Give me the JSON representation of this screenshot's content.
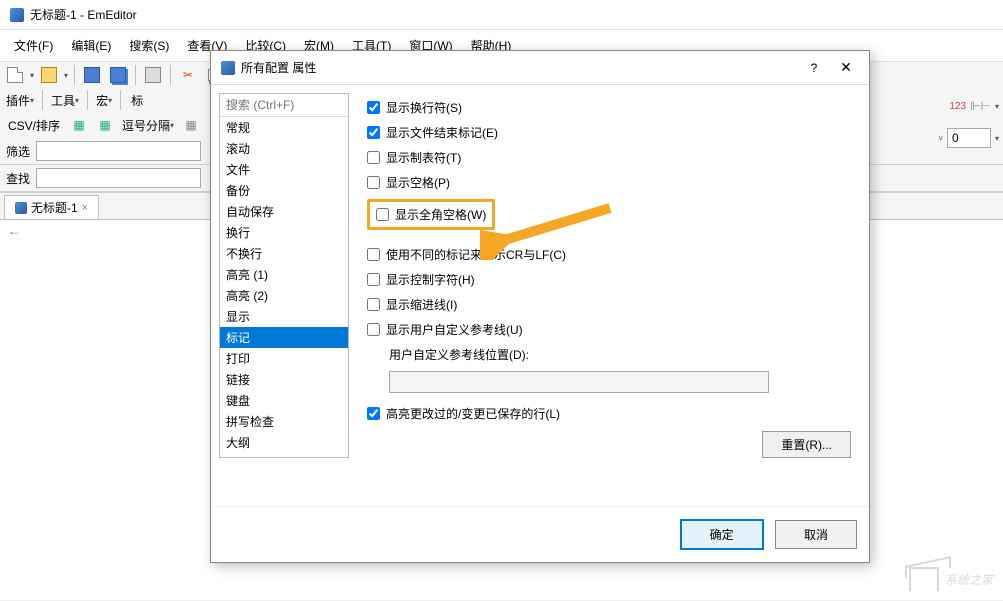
{
  "window": {
    "title": "无标题-1 - EmEditor"
  },
  "menu": {
    "file": "文件(F)",
    "edit": "编辑(E)",
    "search": "搜索(S)",
    "view": "查看(V)",
    "compare": "比较(C)",
    "macro": "宏(M)",
    "tools": "工具(T)",
    "window": "窗口(W)",
    "help": "帮助(H)"
  },
  "toolbar": {
    "plugins": "插件",
    "tools": "工具",
    "macro": "宏",
    "tabs_label": "标",
    "csv_sort": "CSV/排序",
    "comma_split": "逗号分隔",
    "filter_label": "筛选",
    "search_label": "查找",
    "col_number": "0",
    "ruler_mark": "123"
  },
  "tabs": {
    "doc1": "无标题-1"
  },
  "editor": {
    "eof_marker": "←"
  },
  "dialog": {
    "title": "所有配置 属性",
    "help": "?",
    "search_placeholder": "搜索 (Ctrl+F)",
    "categories": [
      "常规",
      "滚动",
      "文件",
      "备份",
      "自动保存",
      "换行",
      "不换行",
      "高亮 (1)",
      "高亮 (2)",
      "显示",
      "标记",
      "打印",
      "链接",
      "键盘",
      "拼写检查",
      "大纲"
    ],
    "selected_category_index": 10,
    "options": {
      "show_newline": "显示换行符(S)",
      "show_eof": "显示文件结束标记(E)",
      "show_tab": "显示制表符(T)",
      "show_space": "显示空格(P)",
      "show_fullwidth_space": "显示全角空格(W)",
      "diff_crlf": "使用不同的标记来显示CR与LF(C)",
      "show_ctrl": "显示控制字符(H)",
      "show_indent": "显示缩进线(I)",
      "show_user_guide": "显示用户自定义参考线(U)",
      "user_guide_pos": "用户自定义参考线位置(D):",
      "highlight_changed": "高亮更改过的/变更已保存的行(L)"
    },
    "checked": {
      "show_newline": true,
      "show_eof": true,
      "highlight_changed": true
    },
    "reset": "重置(R)...",
    "ok": "确定",
    "cancel": "取消"
  },
  "watermark": "系统之家"
}
